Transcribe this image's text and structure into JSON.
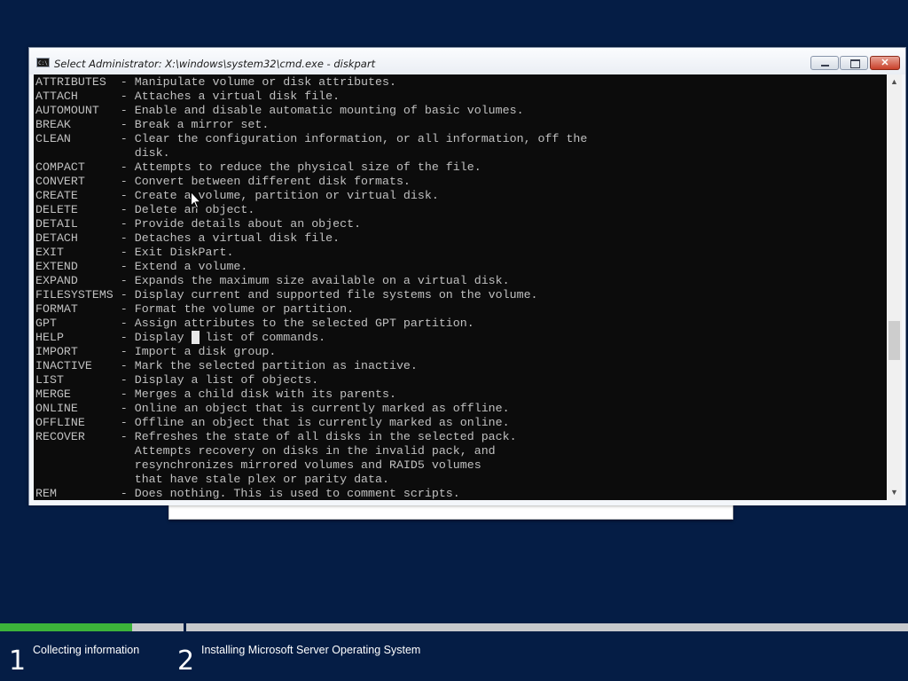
{
  "window": {
    "title": "Select Administrator: X:\\windows\\system32\\cmd.exe - diskpart",
    "icon_text": "C:\\",
    "icon_name": "cmd-icon"
  },
  "console": {
    "lines": [
      "ATTRIBUTES  - Manipulate volume or disk attributes.",
      "ATTACH      - Attaches a virtual disk file.",
      "AUTOMOUNT   - Enable and disable automatic mounting of basic volumes.",
      "BREAK       - Break a mirror set.",
      "CLEAN       - Clear the configuration information, or all information, off the",
      "              disk.",
      "COMPACT     - Attempts to reduce the physical size of the file.",
      "CONVERT     - Convert between different disk formats.",
      "CREATE      - Create a volume, partition or virtual disk.",
      "DELETE      - Delete an object.",
      "DETAIL      - Provide details about an object.",
      "DETACH      - Detaches a virtual disk file.",
      "EXIT        - Exit DiskPart.",
      "EXTEND      - Extend a volume.",
      "EXPAND      - Expands the maximum size available on a virtual disk.",
      "FILESYSTEMS - Display current and supported file systems on the volume.",
      "FORMAT      - Format the volume or partition.",
      "GPT         - Assign attributes to the selected GPT partition.",
      "HELP        - Display a list of commands.",
      "IMPORT      - Import a disk group.",
      "INACTIVE    - Mark the selected partition as inactive.",
      "LIST        - Display a list of objects.",
      "MERGE       - Merges a child disk with its parents.",
      "ONLINE      - Online an object that is currently marked as offline.",
      "OFFLINE     - Offline an object that is currently marked as online.",
      "RECOVER     - Refreshes the state of all disks in the selected pack.",
      "              Attempts recovery on disks in the invalid pack, and",
      "              resynchronizes mirrored volumes and RAID5 volumes",
      "              that have stale plex or parity data.",
      "REM         - Does nothing. This is used to comment scripts."
    ]
  },
  "scrollbar": {
    "position": 0.62
  },
  "installer": {
    "progress_fraction_step1": 0.72,
    "steps": [
      {
        "number": "1",
        "label": "Collecting information"
      },
      {
        "number": "2",
        "label": "Installing Microsoft Server Operating System"
      }
    ]
  },
  "colors": {
    "desktop": "#051d45",
    "console_bg": "#0c0c0c",
    "console_text": "#c0c0c0",
    "progress_fill": "#3cb33a"
  }
}
